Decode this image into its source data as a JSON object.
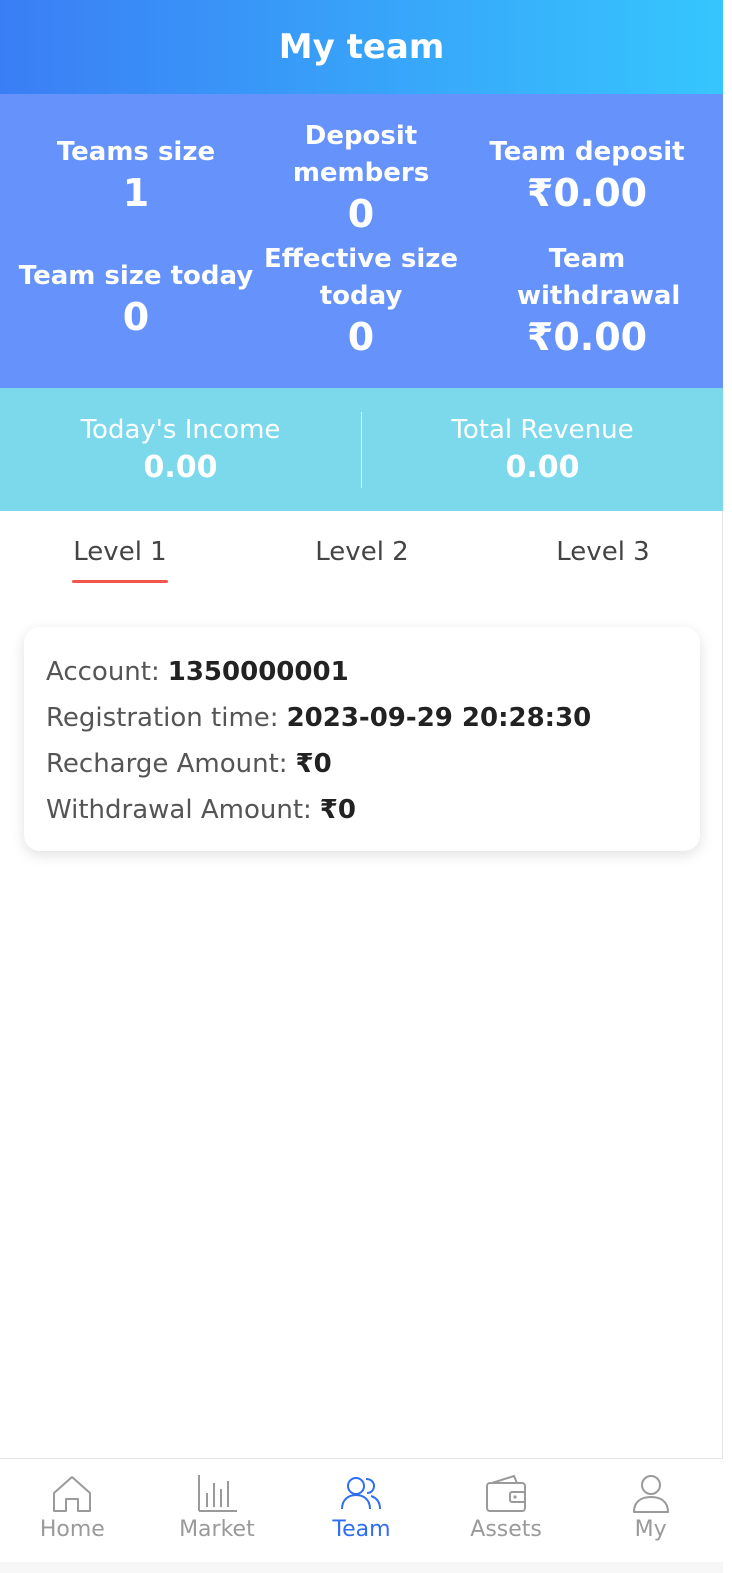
{
  "header": {
    "title": "My team"
  },
  "stats": {
    "teams_size": {
      "label": "Teams size",
      "value": "1"
    },
    "deposit_members": {
      "label": "Deposit members",
      "value": "0"
    },
    "team_deposit": {
      "label": "Team deposit",
      "value": "₹0.00"
    },
    "team_size_today": {
      "label": "Team size today",
      "value": "0"
    },
    "effective_size_today": {
      "label": "Effective size today",
      "value": "0"
    },
    "team_withdrawal": {
      "label": "Team withdrawal",
      "value": "₹0.00"
    }
  },
  "income": {
    "today": {
      "label": "Today's Income",
      "value": "0.00"
    },
    "total": {
      "label": "Total Revenue",
      "value": "0.00"
    }
  },
  "tabs": [
    {
      "label": "Level 1",
      "active": true
    },
    {
      "label": "Level 2",
      "active": false
    },
    {
      "label": "Level 3",
      "active": false
    }
  ],
  "members": [
    {
      "account_label": "Account:",
      "account": "1350000001",
      "registration_label": "Registration time:",
      "registration_time": "2023-09-29 20:28:30",
      "recharge_label": "Recharge Amount:",
      "recharge_amount": "₹0",
      "withdrawal_label": "Withdrawal Amount:",
      "withdrawal_amount": "₹0"
    }
  ],
  "tabbar": {
    "items": [
      {
        "label": "Home",
        "icon": "home-icon",
        "active": false
      },
      {
        "label": "Market",
        "icon": "bar-chart-icon",
        "active": false
      },
      {
        "label": "Team",
        "icon": "team-icon",
        "active": true
      },
      {
        "label": "Assets",
        "icon": "wallet-icon",
        "active": false
      },
      {
        "label": "My",
        "icon": "user-icon",
        "active": false
      }
    ],
    "active_color": "#2f6ef2",
    "inactive_color": "#9a9a9a"
  },
  "colors": {
    "header_gradient_start": "#3a7ef5",
    "header_gradient_end": "#36c6fd",
    "stats_bg": "#6693fb",
    "income_bg": "#7cd9ec",
    "tab_underline": "#f2554a"
  }
}
